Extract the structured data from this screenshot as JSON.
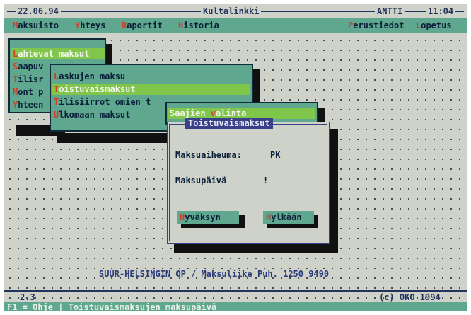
{
  "titlebar": {
    "date": "22.06.94",
    "app_name": "Kultalinkki",
    "user": "ANTTI",
    "time": "11:04"
  },
  "menubar": {
    "items": [
      {
        "hot": "M",
        "rest": "aksuisto"
      },
      {
        "hot": "Y",
        "rest": "hteys"
      },
      {
        "hot": "R",
        "rest": "aportit"
      },
      {
        "hot": "H",
        "rest": "istoria"
      },
      {
        "hot": "P",
        "rest": "erustiedot"
      },
      {
        "hot": "L",
        "rest": "opetus"
      }
    ]
  },
  "menu1": {
    "items": [
      {
        "hot": "L",
        "rest": "ahtevat maksut",
        "selected": true
      },
      {
        "hot": "S",
        "rest": "aapuv",
        "selected": false
      },
      {
        "hot": "T",
        "rest": "ilisr",
        "selected": false
      },
      {
        "hot": "M",
        "rest": "ont p",
        "selected": false
      },
      {
        "hot": "Y",
        "rest": "hteen",
        "selected": false
      }
    ]
  },
  "menu2": {
    "items": [
      {
        "hot": "L",
        "rest": "askujen maksu",
        "selected": false
      },
      {
        "hot": "T",
        "rest": "oistuvaismaksut",
        "selected": true
      },
      {
        "hot": "T",
        "rest": "ilisiirrot omien t",
        "selected": false
      },
      {
        "hot": "U",
        "rest": "lkomaan maksut",
        "selected": false
      }
    ]
  },
  "menu3": {
    "item": {
      "pre": "Saajien ",
      "hot": "v",
      "post": "alinta"
    }
  },
  "dialog": {
    "title": "Toistuvaismaksut",
    "field1_label": "Maksuaiheuma:",
    "field1_value": "PK",
    "field2_label": "Maksupäivä",
    "field2_value": "!",
    "ok_hot": "H",
    "ok_rest": "yväksyn",
    "cancel_hot": "H",
    "cancel_rest": "ylkään"
  },
  "footer": {
    "bank_line": "SUUR-HELSINGIN OP / Maksuliike Puh. 1250 9490",
    "version": "2.3",
    "copyright": "(c) OKO 1994"
  },
  "status": {
    "text": "F1 = Ohje | Toistuvaismaksujen maksupäivä"
  },
  "colors": {
    "menu_green": "#5fa88f",
    "selection_green": "#7fc64a",
    "hotkey_red": "#d83a2a",
    "dialog_border": "#3a3f8a"
  }
}
